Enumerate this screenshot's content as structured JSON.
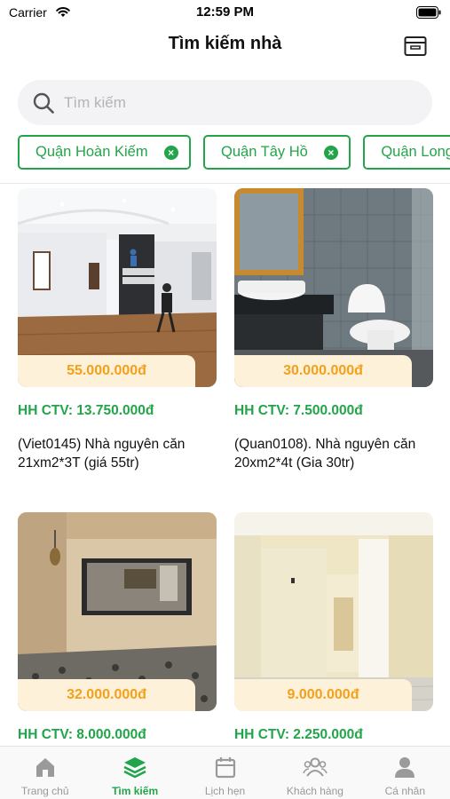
{
  "status_bar": {
    "carrier": "Carrier",
    "time": "12:59 PM"
  },
  "header": {
    "title": "Tìm kiếm nhà",
    "action_icon": "archive-box-icon"
  },
  "search": {
    "placeholder": "Tìm kiếm",
    "value": ""
  },
  "filters": [
    {
      "label": "Quận Hoàn Kiếm"
    },
    {
      "label": "Quận Tây Hồ"
    },
    {
      "label": "Quận Long Biên"
    }
  ],
  "listings": [
    {
      "price": "55.000.000đ",
      "commission": "HH CTV: 13.750.000đ",
      "title": "(Viet0145) Nhà nguyên căn 21xm2*3T (giá 55tr)"
    },
    {
      "price": "30.000.000đ",
      "commission": "HH CTV: 7.500.000đ",
      "title": "(Quan0108). Nhà nguyên căn 20xm2*4t (Gia 30tr)"
    },
    {
      "price": "32.000.000đ",
      "commission": "HH CTV: 8.000.000đ",
      "title": ""
    },
    {
      "price": "9.000.000đ",
      "commission": "HH CTV: 2.250.000đ",
      "title": ""
    }
  ],
  "tabs": [
    {
      "label": "Trang chủ",
      "icon": "home-icon",
      "active": false
    },
    {
      "label": "Tìm kiếm",
      "icon": "layers-icon",
      "active": true
    },
    {
      "label": "Lịch hẹn",
      "icon": "calendar-icon",
      "active": false
    },
    {
      "label": "Khách hàng",
      "icon": "customers-icon",
      "active": false
    },
    {
      "label": "Cá nhân",
      "icon": "user-icon",
      "active": false
    }
  ],
  "colors": {
    "accent_green": "#22a54a",
    "price_orange": "#f4a01a",
    "price_tag_bg": "#fdf1da",
    "search_bg": "#f3f3f5"
  }
}
